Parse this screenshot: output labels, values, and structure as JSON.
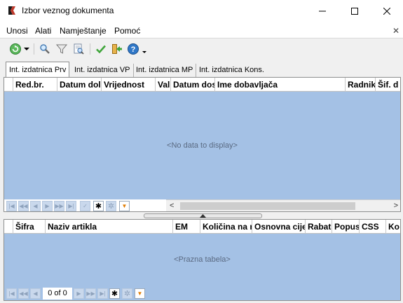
{
  "window": {
    "title": "Izbor veznog dokumenta"
  },
  "menu": {
    "items": [
      "Unosi",
      "Alati",
      "Namještanje",
      "Pomoć"
    ],
    "close_glyph": "✕"
  },
  "toolbar": {
    "icons": [
      "refresh-icon",
      "dropdown-arrow-icon",
      "search-icon",
      "filter-icon",
      "preview-icon",
      "checkmark-icon",
      "exit-icon",
      "help-icon",
      "help-dropdown-icon"
    ]
  },
  "tabs": [
    "Int. izdatnica Prv",
    "Int. izdatnica VP",
    "Int. izdatnica MP",
    "Int. izdatnica Kons."
  ],
  "top_grid": {
    "columns": [
      "Red.br.",
      "Datum dol",
      "Vrijednost",
      "Val",
      "Datum dos",
      "Ime dobavljača",
      "Radnik",
      "Šif. d"
    ],
    "empty_text": "<No data to display>"
  },
  "bottom_grid": {
    "columns": [
      "Šifra",
      "Naziv artikla",
      "EM",
      "Količina na r",
      "Osnovna cije",
      "Rabat",
      "Popus",
      "CSS",
      "Ko"
    ],
    "empty_text": "<Prazna tabela>",
    "record_counter": "0 of 0"
  },
  "colors": {
    "grid_background": "#a4c1e5",
    "accent_green": "#3fa53a",
    "help_blue": "#2f77c8"
  }
}
